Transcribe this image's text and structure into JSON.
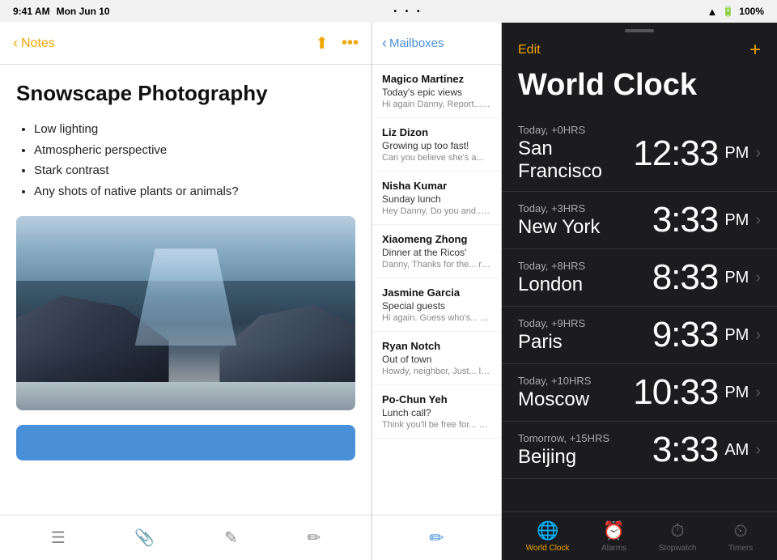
{
  "statusBar": {
    "time": "9:41 AM",
    "date": "Mon Jun 10",
    "dots": "• • •",
    "wifi": "WiFi",
    "battery": "100%"
  },
  "notes": {
    "backLabel": "Notes",
    "title": "Snowscape Photography",
    "bullets": [
      "Low lighting",
      "Atmospheric perspective",
      "Stark contrast",
      "Any shots of native plants or animals?"
    ],
    "toolbar": {
      "list_icon": "≡",
      "attach_icon": "📎",
      "pen_icon": "✏",
      "compose_icon": "✏"
    }
  },
  "mail": {
    "backLabel": "Mailboxes",
    "items": [
      {
        "sender": "Magico Martinez",
        "subject": "Today's epic views",
        "preview": "Hi again Danny, Report... Wide open skies, a gen"
      },
      {
        "sender": "Liz Dizon",
        "subject": "Growing up too fast!",
        "preview": "Can you believe she's a..."
      },
      {
        "sender": "Nisha Kumar",
        "subject": "Sunday lunch",
        "preview": "Hey Danny, Do you and... dad? If you two join, th"
      },
      {
        "sender": "Xiaomeng Zhong",
        "subject": "Dinner at the Ricos'",
        "preview": "Danny, Thanks for the... remembered to take on"
      },
      {
        "sender": "Jasmine Garcia",
        "subject": "Special guests",
        "preview": "Hi again. Guess who's... know how to make me"
      },
      {
        "sender": "Ryan Notch",
        "subject": "Out of town",
        "preview": "Howdy, neighbor, Just... leaving Tuesday and w"
      },
      {
        "sender": "Po-Chun Yeh",
        "subject": "Lunch call?",
        "preview": "Think you'll be free for... you think might work a"
      }
    ]
  },
  "clock": {
    "editLabel": "Edit",
    "addLabel": "+",
    "title": "World Clock",
    "items": [
      {
        "offset": "Today, +0HRS",
        "city": "San Francisco",
        "time": "12:33",
        "ampm": "PM"
      },
      {
        "offset": "Today, +3HRS",
        "city": "New York",
        "time": "3:33",
        "ampm": "PM"
      },
      {
        "offset": "Today, +8HRS",
        "city": "London",
        "time": "8:33",
        "ampm": "PM"
      },
      {
        "offset": "Today, +9HRS",
        "city": "Paris",
        "time": "9:33",
        "ampm": "PM"
      },
      {
        "offset": "Today, +10HRS",
        "city": "Moscow",
        "time": "10:33",
        "ampm": "PM"
      },
      {
        "offset": "Tomorrow, +15HRS",
        "city": "Beijing",
        "time": "3:33",
        "ampm": "AM"
      }
    ],
    "tabs": [
      {
        "label": "World Clock",
        "icon": "🌐",
        "active": true
      },
      {
        "label": "Alarms",
        "icon": "⏰",
        "active": false
      },
      {
        "label": "Stopwatch",
        "icon": "⏱",
        "active": false
      },
      {
        "label": "Timers",
        "icon": "⏲",
        "active": false
      }
    ]
  }
}
